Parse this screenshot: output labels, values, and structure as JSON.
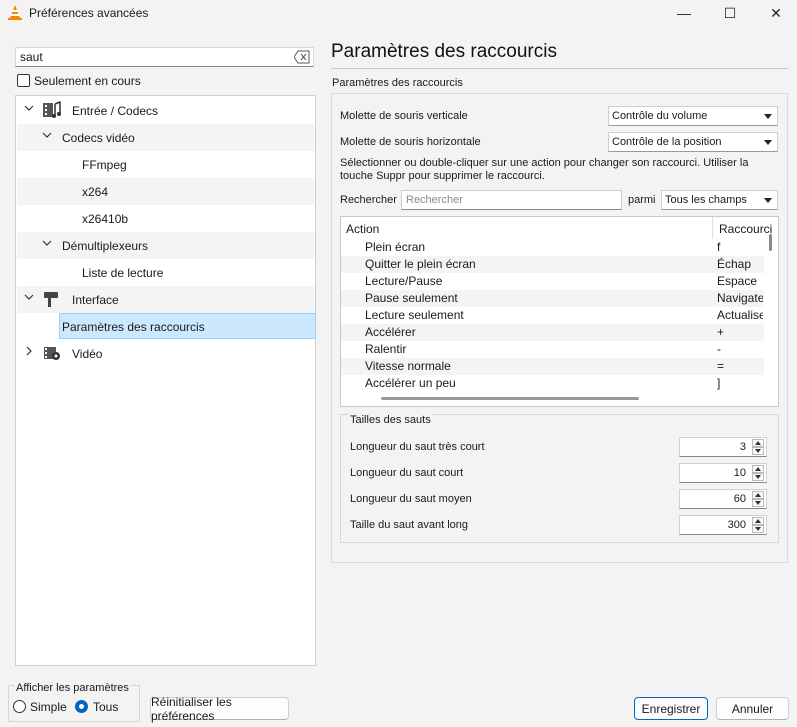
{
  "window": {
    "title": "Préférences avancées",
    "minimize": "—",
    "maximize": "☐",
    "close": "✕"
  },
  "search": {
    "value": "saut"
  },
  "only_current": {
    "label": "Seulement en cours",
    "checked": false
  },
  "tree": {
    "items": [
      {
        "label": "Entrée / Codecs",
        "icon": "codec-icon"
      },
      {
        "label": "Codecs vidéo"
      },
      {
        "label": "FFmpeg"
      },
      {
        "label": "x264"
      },
      {
        "label": "x26410b"
      },
      {
        "label": "Démultiplexeurs"
      },
      {
        "label": "Liste de lecture"
      },
      {
        "label": "Interface",
        "icon": "interface-icon"
      },
      {
        "label": "Paramètres des raccourcis",
        "selected": true
      },
      {
        "label": "Vidéo",
        "icon": "video-icon"
      }
    ]
  },
  "panel": {
    "title": "Paramètres des raccourcis",
    "section": "Paramètres des raccourcis",
    "wheel_vertical_label": "Molette de souris verticale",
    "wheel_vertical_value": "Contrôle du volume",
    "wheel_horizontal_label": "Molette de souris horizontale",
    "wheel_horizontal_value": "Contrôle de la position",
    "hint": "Sélectionner ou double-cliquer sur une action pour changer son raccourci. Utiliser la touche Suppr pour supprimer le raccourci.",
    "search_label": "Rechercher",
    "search_placeholder": "Rechercher",
    "among_label": "parmi",
    "among_value": "Tous les champs"
  },
  "table": {
    "headers": {
      "action": "Action",
      "shortcut": "Raccourci"
    },
    "rows": [
      {
        "action": "Plein écran",
        "key": "f"
      },
      {
        "action": "Quitter le plein écran",
        "key": "Échap"
      },
      {
        "action": "Lecture/Pause",
        "key": "Espace"
      },
      {
        "action": "Pause seulement",
        "key": "Navigate"
      },
      {
        "action": "Lecture seulement",
        "key": "Actualise"
      },
      {
        "action": "Accélérer",
        "key": "+"
      },
      {
        "action": "Ralentir",
        "key": "-"
      },
      {
        "action": "Vitesse normale",
        "key": "="
      },
      {
        "action": "Accélérer un peu",
        "key": "]"
      }
    ]
  },
  "jumps": {
    "title": "Tailles des sauts",
    "items": [
      {
        "label": "Longueur du saut très court",
        "value": "3"
      },
      {
        "label": "Longueur du saut court",
        "value": "10"
      },
      {
        "label": "Longueur du saut moyen",
        "value": "60"
      },
      {
        "label": "Taille du saut avant long",
        "value": "300"
      }
    ]
  },
  "footer": {
    "show_label": "Afficher les paramètres",
    "simple": "Simple",
    "all": "Tous",
    "selected_mode": "Tous",
    "reset": "Réinitialiser les préférences",
    "save": "Enregistrer",
    "cancel": "Annuler"
  },
  "colors": {
    "accent": "#0067c0",
    "selection": "#cce8ff",
    "vlc_orange": "#f08a00"
  }
}
